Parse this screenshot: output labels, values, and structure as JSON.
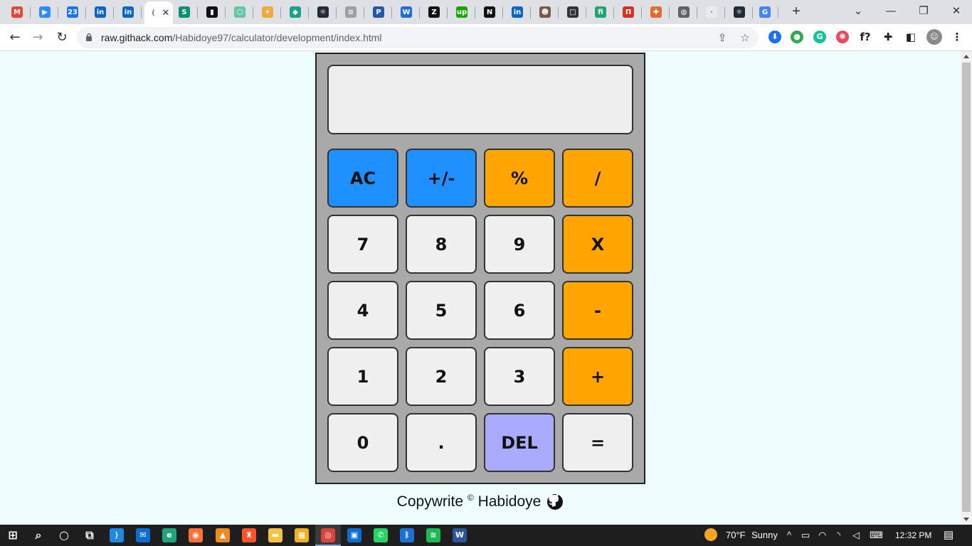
{
  "browser": {
    "tabs": [
      {
        "icon": "gmail-icon",
        "glyph": "M",
        "color": "#ea4335"
      },
      {
        "icon": "zoom-icon",
        "glyph": "▶",
        "color": "#2d8cff"
      },
      {
        "icon": "calendar-icon",
        "glyph": "23",
        "color": "#1a73e8"
      },
      {
        "icon": "linkedin-icon",
        "glyph": "in",
        "color": "#0a66c2"
      },
      {
        "icon": "linkedin-icon",
        "glyph": "in",
        "color": "#0a66c2"
      },
      {
        "icon": "loading-icon",
        "glyph": "(",
        "color": "#ffffff",
        "active": true
      },
      {
        "icon": "s-icon",
        "glyph": "S",
        "color": "#0b8f6f"
      },
      {
        "icon": "bars-icon",
        "glyph": "▮",
        "color": "#111111"
      },
      {
        "icon": "hex-icon",
        "glyph": "⬡",
        "color": "#63c7a5"
      },
      {
        "icon": "sparkle-icon",
        "glyph": "✦",
        "color": "#f2a93b"
      },
      {
        "icon": "diamond-icon",
        "glyph": "◆",
        "color": "#1aa38c"
      },
      {
        "icon": "react-icon",
        "glyph": "⚛",
        "color": "#222b36"
      },
      {
        "icon": "cisco-icon",
        "glyph": "≡",
        "color": "#9aa0a6"
      },
      {
        "icon": "p-icon",
        "glyph": "P",
        "color": "#2458a6"
      },
      {
        "icon": "w-icon",
        "glyph": "W",
        "color": "#1b6fd6"
      },
      {
        "icon": "z-icon",
        "glyph": "Z",
        "color": "#111111"
      },
      {
        "icon": "upwork-icon",
        "glyph": "up",
        "color": "#14a800"
      },
      {
        "icon": "n-icon",
        "glyph": "N",
        "color": "#111111"
      },
      {
        "icon": "linkedin-icon",
        "glyph": "in",
        "color": "#0a66c2"
      },
      {
        "icon": "person-icon",
        "glyph": "☻",
        "color": "#7a5c44"
      },
      {
        "icon": "square-icon",
        "glyph": "□",
        "color": "#333333"
      },
      {
        "icon": "f-icon",
        "glyph": "fi",
        "color": "#25a36f"
      },
      {
        "icon": "n-red-icon",
        "glyph": "Π",
        "color": "#d93025"
      },
      {
        "icon": "puzzle-color-icon",
        "glyph": "✚",
        "color": "#e36b2c"
      },
      {
        "icon": "globe-icon",
        "glyph": "◍",
        "color": "#5f6368"
      },
      {
        "icon": "blank-page-icon",
        "glyph": "·",
        "color": "#e8eaed"
      },
      {
        "icon": "react-icon",
        "glyph": "⚛",
        "color": "#222b36"
      },
      {
        "icon": "google-icon",
        "glyph": "G",
        "color": "#4285f4"
      }
    ],
    "new_tab": "+",
    "window_controls": {
      "dropdown": "⌄",
      "minimize": "—",
      "restore": "❐",
      "close": "✕"
    },
    "nav": {
      "back": "←",
      "forward": "→",
      "reload": "↻"
    },
    "address": {
      "host": "raw.githack.com",
      "path": "/Habidoye97/calculator/development/index.html"
    },
    "extensions": [
      {
        "icon": "download-icon",
        "glyph": "⬇",
        "color": "#1a73e8"
      },
      {
        "icon": "lightbulb-icon",
        "glyph": "●",
        "color": "#34a853"
      },
      {
        "icon": "grammarly-icon",
        "glyph": "G",
        "color": "#15c39a"
      },
      {
        "icon": "colorwheel-icon",
        "glyph": "✺",
        "color": "#e84a5f"
      },
      {
        "icon": "fx-icon",
        "glyph": "f?",
        "color": "#ffffff"
      },
      {
        "icon": "puzzle-icon",
        "glyph": "✚",
        "color": "#ffffff"
      },
      {
        "icon": "sidepanel-icon",
        "glyph": "◧",
        "color": "#ffffff"
      },
      {
        "icon": "profile-avatar-icon",
        "glyph": "☺",
        "color": "#8a8a8a"
      },
      {
        "icon": "menu-icon",
        "glyph": "⋮",
        "color": "#ffffff"
      }
    ]
  },
  "calculator": {
    "display": "",
    "keys": [
      {
        "label": "AC",
        "name": "all-clear",
        "style": "blue"
      },
      {
        "label": "+/-",
        "name": "toggle-sign",
        "style": "blue"
      },
      {
        "label": "%",
        "name": "percent",
        "style": "orange"
      },
      {
        "label": "/",
        "name": "divide",
        "style": "orange"
      },
      {
        "label": "7",
        "name": "digit-7",
        "style": "plain"
      },
      {
        "label": "8",
        "name": "digit-8",
        "style": "plain"
      },
      {
        "label": "9",
        "name": "digit-9",
        "style": "plain"
      },
      {
        "label": "X",
        "name": "multiply",
        "style": "orange"
      },
      {
        "label": "4",
        "name": "digit-4",
        "style": "plain"
      },
      {
        "label": "5",
        "name": "digit-5",
        "style": "plain"
      },
      {
        "label": "6",
        "name": "digit-6",
        "style": "plain"
      },
      {
        "label": "-",
        "name": "subtract",
        "style": "orange"
      },
      {
        "label": "1",
        "name": "digit-1",
        "style": "plain"
      },
      {
        "label": "2",
        "name": "digit-2",
        "style": "plain"
      },
      {
        "label": "3",
        "name": "digit-3",
        "style": "plain"
      },
      {
        "label": "+",
        "name": "add",
        "style": "orange"
      },
      {
        "label": "0",
        "name": "digit-0",
        "style": "plain"
      },
      {
        "label": ".",
        "name": "decimal",
        "style": "plain"
      },
      {
        "label": "DEL",
        "name": "delete",
        "style": "lav"
      },
      {
        "label": "=",
        "name": "equals",
        "style": "plain"
      }
    ],
    "colors": {
      "blue": "#1e90ff",
      "orange": "#ffa500",
      "lav": "#aaaaff",
      "plain": "#f0f0f0",
      "body": "#a9a9a9"
    }
  },
  "footer": {
    "text": "Copywrite",
    "copyright": "©",
    "author": "Habidoye",
    "icon": "github-icon"
  },
  "taskbar": {
    "apps": [
      {
        "icon": "windows-start-icon",
        "glyph": "⊞",
        "color": "#1e1e1e"
      },
      {
        "icon": "search-icon",
        "glyph": "⌕",
        "color": "#1e1e1e"
      },
      {
        "icon": "cortana-icon",
        "glyph": "○",
        "color": "#1e1e1e"
      },
      {
        "icon": "task-view-icon",
        "glyph": "⧉",
        "color": "#1e1e1e"
      },
      {
        "icon": "vscode-icon",
        "glyph": "⟩",
        "color": "#1e88e5"
      },
      {
        "icon": "mail-icon",
        "glyph": "✉",
        "color": "#0a6fd1"
      },
      {
        "icon": "edge-icon",
        "glyph": "e",
        "color": "#1fa57c"
      },
      {
        "icon": "firefox-icon",
        "glyph": "◉",
        "color": "#ff7139"
      },
      {
        "icon": "vlc-icon",
        "glyph": "▲",
        "color": "#f08a1c"
      },
      {
        "icon": "brave-icon",
        "glyph": "♜",
        "color": "#fb542b"
      },
      {
        "icon": "file-explorer-icon",
        "glyph": "▬",
        "color": "#f6c244"
      },
      {
        "icon": "store-icon",
        "glyph": "▦",
        "color": "#f2b01e"
      },
      {
        "icon": "chrome-icon",
        "glyph": "◎",
        "color": "#db4437"
      },
      {
        "icon": "terminal-icon",
        "glyph": "▣",
        "color": "#0a6fd1"
      },
      {
        "icon": "whatsapp-icon",
        "glyph": "✆",
        "color": "#25d366"
      },
      {
        "icon": "bluetooth-icon",
        "glyph": "ᛒ",
        "color": "#1e6fd6"
      },
      {
        "icon": "spotify-icon",
        "glyph": "≋",
        "color": "#1db954"
      },
      {
        "icon": "word-icon",
        "glyph": "W",
        "color": "#2b579a"
      }
    ],
    "weather": {
      "temp": "70°F",
      "condition": "Sunny"
    },
    "tray": {
      "chevron": "^",
      "battery": "▭",
      "network": "◠",
      "wifi": "◝",
      "volume": "◁",
      "keyboard": "⌨"
    },
    "time": "12:32 PM",
    "notifications": "▤"
  }
}
